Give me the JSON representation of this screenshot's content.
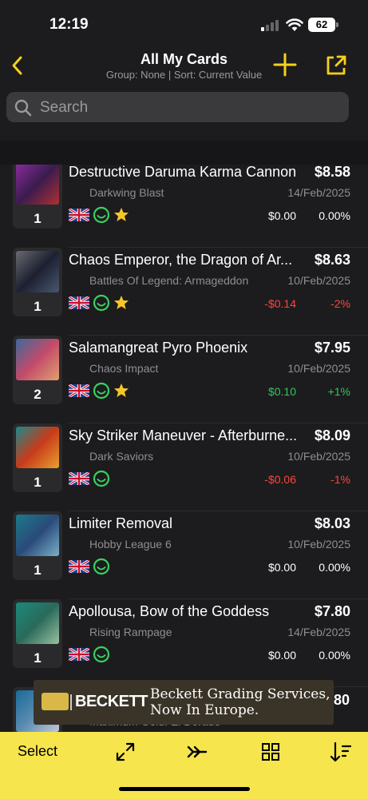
{
  "status_bar": {
    "time": "12:19",
    "battery": "62"
  },
  "nav": {
    "title": "All My Cards",
    "subtitle": "Group: None | Sort: Current Value"
  },
  "search": {
    "placeholder": "Search"
  },
  "cards": [
    {
      "name": "Destructive Daruma Karma Cannon",
      "price": "$8.58",
      "set": "Darkwing Blast",
      "date": "14/Feb/2025",
      "qty": "1",
      "change": "$0.00",
      "change_pct": "0.00%",
      "trend": "flat",
      "starred": true
    },
    {
      "name": "Chaos Emperor, the Dragon of Ar...",
      "price": "$8.63",
      "set": "Battles Of Legend: Armageddon",
      "date": "10/Feb/2025",
      "qty": "1",
      "change": "-$0.14",
      "change_pct": "-2%",
      "trend": "down",
      "starred": true
    },
    {
      "name": "Salamangreat Pyro Phoenix",
      "price": "$7.95",
      "set": "Chaos Impact",
      "date": "10/Feb/2025",
      "qty": "2",
      "change": "$0.10",
      "change_pct": "+1%",
      "trend": "up",
      "starred": true
    },
    {
      "name": "Sky Striker Maneuver - Afterburne...",
      "price": "$8.09",
      "set": "Dark Saviors",
      "date": "10/Feb/2025",
      "qty": "1",
      "change": "-$0.06",
      "change_pct": "-1%",
      "trend": "down",
      "starred": false
    },
    {
      "name": "Limiter Removal",
      "price": "$8.03",
      "set": "Hobby League 6",
      "date": "10/Feb/2025",
      "qty": "1",
      "change": "$0.00",
      "change_pct": "0.00%",
      "trend": "flat",
      "starred": false
    },
    {
      "name": "Apollousa, Bow of the Goddess",
      "price": "$7.80",
      "set": "Rising Rampage",
      "date": "14/Feb/2025",
      "qty": "1",
      "change": "$0.00",
      "change_pct": "0.00%",
      "trend": "flat",
      "starred": false
    }
  ],
  "partial_card": {
    "price": "80",
    "set": "Maximum Gold: El Dorado",
    "date": "10/Feb/2025"
  },
  "ad": {
    "brand": "BECKETT",
    "line1": "Beckett Grading Services,",
    "line2": "Now In Europe."
  },
  "toolbar": {
    "select_label": "Select"
  },
  "icons": {
    "back": "chevron-left-icon",
    "add": "plus-icon",
    "share": "share-icon",
    "search": "search-icon",
    "flag": "uk-flag-icon",
    "condition": "smiley-icon",
    "favorite": "star-icon",
    "expand": "expand-icon",
    "forward": "double-chevron-right-icon",
    "grid": "grid-icon",
    "sort": "sort-icon"
  },
  "colors": {
    "accent": "#f6d11a",
    "toolbar": "#f6e54d",
    "positive": "#32c759",
    "negative": "#ff453a",
    "condition": "#3ad060",
    "background": "#1c1c1e",
    "search_bg": "#3a3a3c"
  }
}
